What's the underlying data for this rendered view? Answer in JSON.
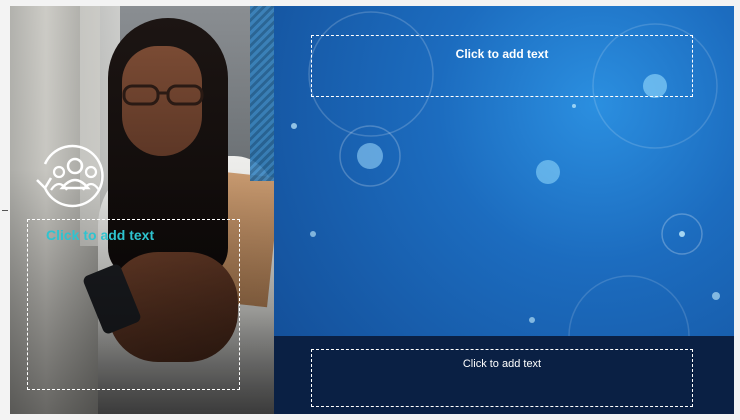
{
  "slide": {
    "top_placeholder": {
      "label": "Click to add text"
    },
    "bottom_placeholder": {
      "label": "Click to add text"
    },
    "left_placeholder": {
      "label": "Click to add text"
    },
    "icon": {
      "name": "team-refresh-icon",
      "color": "#ffffff"
    }
  },
  "colors": {
    "blue_panel": "#1c6cbf",
    "bottom_band": "#0a2044",
    "left_text_accent": "#2ec4d0"
  }
}
